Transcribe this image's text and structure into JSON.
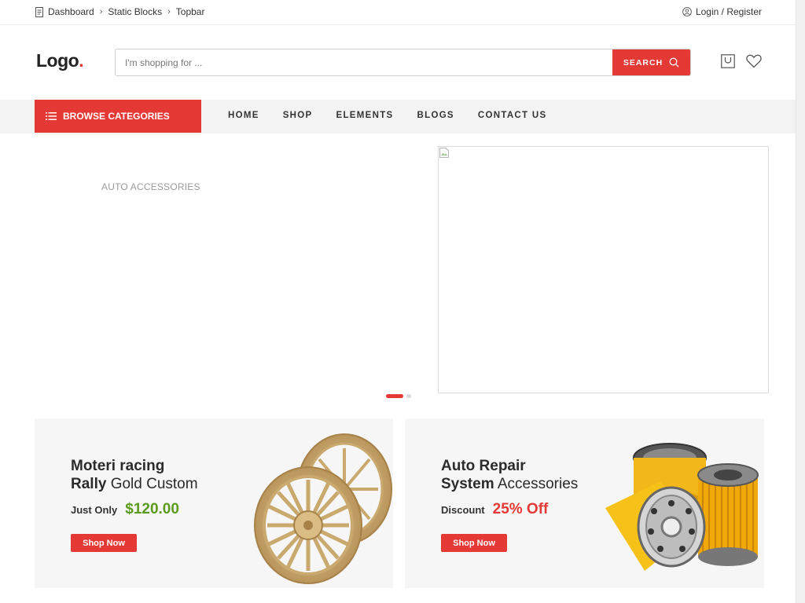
{
  "topbar": {
    "breadcrumb": [
      "Dashboard",
      "Static Blocks",
      "Topbar"
    ],
    "account_label": "Login / Register"
  },
  "header": {
    "logo_text": "Logo",
    "logo_dot": ".",
    "search": {
      "placeholder": "I'm shopping for ...",
      "button_label": "SEARCH"
    }
  },
  "nav": {
    "browse_label": "BROWSE CATEGORIES",
    "links": [
      "HOME",
      "SHOP",
      "ELEMENTS",
      "BLOGS",
      "CONTACT US"
    ]
  },
  "hero": {
    "caption": "AUTO ACCESSORIES",
    "slides_total": 2,
    "active_slide": 1
  },
  "banners": [
    {
      "line1": "Moteri racing",
      "line2_bold": "Rally",
      "line2_rest": "Gold Custom",
      "price_label": "Just Only",
      "price_value": "$120.00",
      "button_label": "Shop Now",
      "image": "gold-alloy-wheels"
    },
    {
      "line1": "Auto Repair",
      "line2_bold": "System",
      "line2_rest": "Accessories",
      "price_label": "Discount",
      "price_value": "25% Off",
      "button_label": "Shop Now",
      "image": "oil-filters"
    }
  ],
  "colors": {
    "accent": "#e53935",
    "price_green": "#5a9a1f",
    "nav_bg": "#f3f3f3",
    "banner_bg": "#f6f6f6"
  },
  "icons": [
    "document-icon",
    "chevron-right-icon",
    "user-icon",
    "search-icon",
    "cart-icon",
    "heart-icon",
    "menu-list-icon",
    "broken-image-icon"
  ]
}
